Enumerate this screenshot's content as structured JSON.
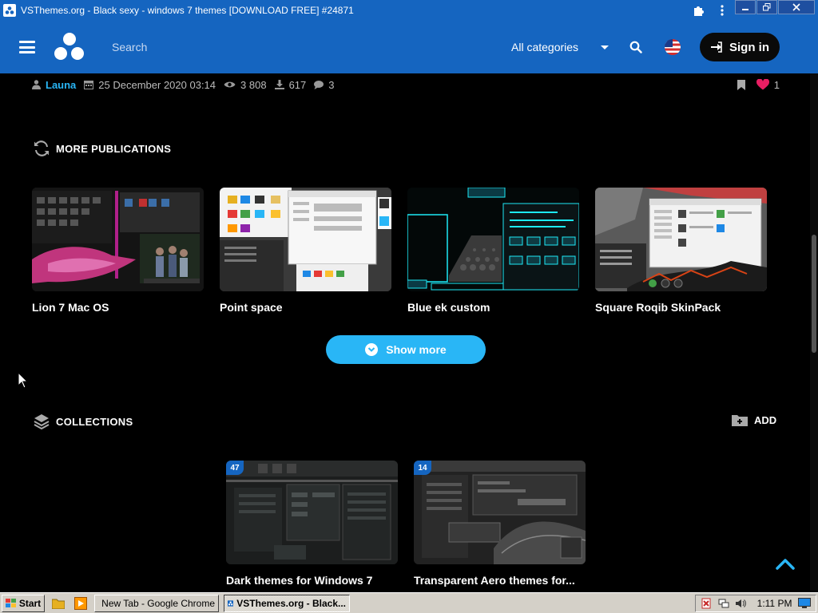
{
  "window": {
    "title": "VSThemes.org - Black sexy - windows 7 themes [DOWNLOAD FREE] #24871",
    "buttons": [
      "minimize",
      "restore",
      "close"
    ]
  },
  "header": {
    "search_placeholder": "Search",
    "category": "All categories",
    "signin_label": "Sign in",
    "brand_color": "#1565c0"
  },
  "meta": {
    "author": "Launa",
    "date": "25 December 2020 03:14",
    "views": "3 808",
    "downloads": "617",
    "comments": "3",
    "likes": "1"
  },
  "more_publications": {
    "heading": "MORE PUBLICATIONS",
    "items": [
      {
        "name": "Lion 7 Mac OS"
      },
      {
        "name": "Point space"
      },
      {
        "name": "Blue ek custom"
      },
      {
        "name": "Square Roqib SkinPack"
      }
    ],
    "show_more_label": "Show more"
  },
  "collections": {
    "heading": "COLLECTIONS",
    "add_label": "ADD",
    "items": [
      {
        "name": "Dark themes for Windows 7",
        "count": "47"
      },
      {
        "name": "Transparent Aero themes for...",
        "count": "14"
      }
    ]
  },
  "taskbar": {
    "start_label": "Start",
    "tasks": [
      {
        "label": "New Tab - Google Chrome",
        "active": false
      },
      {
        "label": "VSThemes.org - Black...",
        "active": true
      }
    ],
    "clock": "1:11 PM"
  }
}
